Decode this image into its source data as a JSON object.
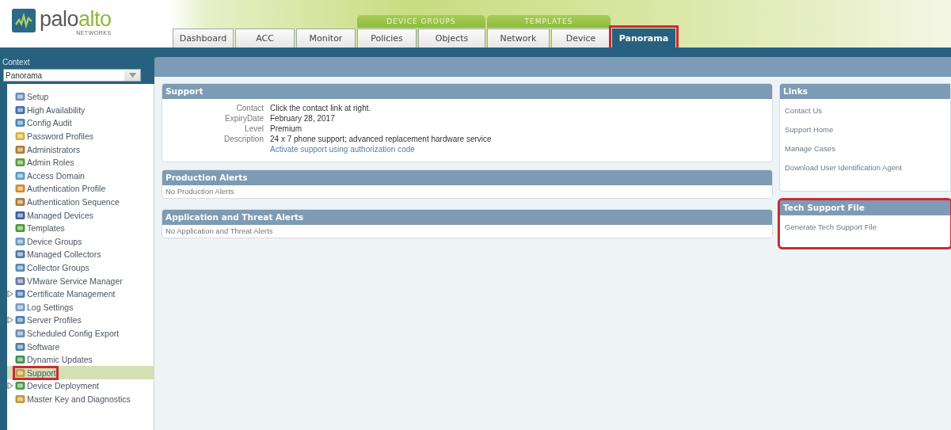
{
  "logo": {
    "word_1": "palo",
    "word_2": "alto",
    "tagline": "NETWORKS"
  },
  "tab_groups": [
    {
      "label": "DEVICE GROUPS"
    },
    {
      "label": "TEMPLATES"
    }
  ],
  "tabs": [
    {
      "label": "Dashboard",
      "selected": false,
      "highlighted": false
    },
    {
      "label": "ACC",
      "selected": false,
      "highlighted": false
    },
    {
      "label": "Monitor",
      "selected": false,
      "highlighted": false
    },
    {
      "label": "Policies",
      "selected": false,
      "highlighted": false
    },
    {
      "label": "Objects",
      "selected": false,
      "highlighted": false
    },
    {
      "label": "Network",
      "selected": false,
      "highlighted": false
    },
    {
      "label": "Device",
      "selected": false,
      "highlighted": false
    },
    {
      "label": "Panorama",
      "selected": true,
      "highlighted": true
    }
  ],
  "context": {
    "label": "Context",
    "value": "Panorama"
  },
  "sidebar": {
    "items": [
      {
        "label": "Setup",
        "selected": false,
        "highlighted": false
      },
      {
        "label": "High Availability",
        "selected": false,
        "highlighted": false
      },
      {
        "label": "Config Audit",
        "selected": false,
        "highlighted": false
      },
      {
        "label": "Password Profiles",
        "selected": false,
        "highlighted": false
      },
      {
        "label": "Administrators",
        "selected": false,
        "highlighted": false
      },
      {
        "label": "Admin Roles",
        "selected": false,
        "highlighted": false
      },
      {
        "label": "Access Domain",
        "selected": false,
        "highlighted": false
      },
      {
        "label": "Authentication Profile",
        "selected": false,
        "highlighted": false
      },
      {
        "label": "Authentication Sequence",
        "selected": false,
        "highlighted": false
      },
      {
        "label": "Managed Devices",
        "selected": false,
        "highlighted": false
      },
      {
        "label": "Templates",
        "selected": false,
        "highlighted": false
      },
      {
        "label": "Device Groups",
        "selected": false,
        "highlighted": false
      },
      {
        "label": "Managed Collectors",
        "selected": false,
        "highlighted": false
      },
      {
        "label": "Collector Groups",
        "selected": false,
        "highlighted": false
      },
      {
        "label": "VMware Service Manager",
        "selected": false,
        "highlighted": false
      },
      {
        "label": "Certificate Management",
        "selected": false,
        "highlighted": false,
        "expanded": false
      },
      {
        "label": "Log Settings",
        "selected": false,
        "highlighted": false
      },
      {
        "label": "Server Profiles",
        "selected": false,
        "highlighted": false,
        "expanded": false
      },
      {
        "label": "Scheduled Config Export",
        "selected": false,
        "highlighted": false
      },
      {
        "label": "Software",
        "selected": false,
        "highlighted": false
      },
      {
        "label": "Dynamic Updates",
        "selected": false,
        "highlighted": false
      },
      {
        "label": "Support",
        "selected": true,
        "highlighted": true
      },
      {
        "label": "Device Deployment",
        "selected": false,
        "highlighted": false,
        "expanded": false
      },
      {
        "label": "Master Key and Diagnostics",
        "selected": false,
        "highlighted": false
      }
    ]
  },
  "support": {
    "title": "Support",
    "fields": [
      {
        "label": "Contact",
        "value": "Click the contact link at right."
      },
      {
        "label": "ExpiryDate",
        "value": "February 28, 2017"
      },
      {
        "label": "Level",
        "value": "Premium"
      },
      {
        "label": "Description",
        "value": "24 x 7 phone support; advanced replacement hardware service"
      }
    ],
    "link": "Activate support using authorization code"
  },
  "production_alerts": {
    "title": "Production Alerts",
    "message": "No Production Alerts"
  },
  "threat_alerts": {
    "title": "Application and Threat Alerts",
    "message": "No Application and Threat Alerts"
  },
  "links": {
    "title": "Links",
    "items": [
      "Contact Us",
      "Support Home",
      "Manage Cases",
      "Download User Identification Agent"
    ]
  },
  "tech_support": {
    "title": "Tech Support File",
    "link": "Generate Tech Support File",
    "highlighted": true
  }
}
